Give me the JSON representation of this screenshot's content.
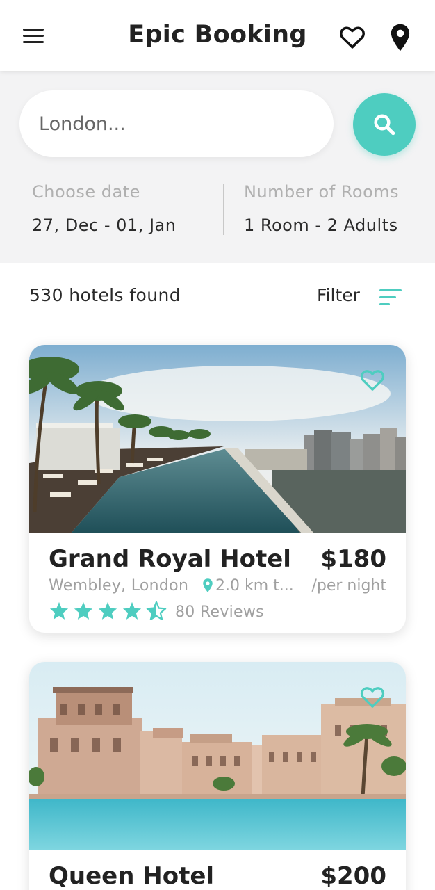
{
  "app": {
    "title": "Epic Booking",
    "accent_color": "#4ecdc0",
    "icons": [
      "menu-icon",
      "heart-outline-icon",
      "location-pin-icon",
      "search-icon",
      "filter-icon"
    ]
  },
  "search": {
    "placeholder": "London...",
    "date_label": "Choose date",
    "date_value": "27, Dec - 01, Jan",
    "rooms_label": "Number of Rooms",
    "rooms_value": "1 Room - 2 Adults"
  },
  "results": {
    "count_text": "530 hotels found",
    "filter_label": "Filter"
  },
  "hotels": [
    {
      "name": "Grand Royal Hotel",
      "price": "$180",
      "location": "Wembley, London",
      "distance": "2.0 km t...",
      "per_night": "/per night",
      "rating": 4.5,
      "reviews": "80 Reviews",
      "image": "rooftop-infinity-pool-photo"
    },
    {
      "name": "Queen Hotel",
      "price": "$200",
      "image": "arabian-style-resort-pool-photo"
    }
  ]
}
